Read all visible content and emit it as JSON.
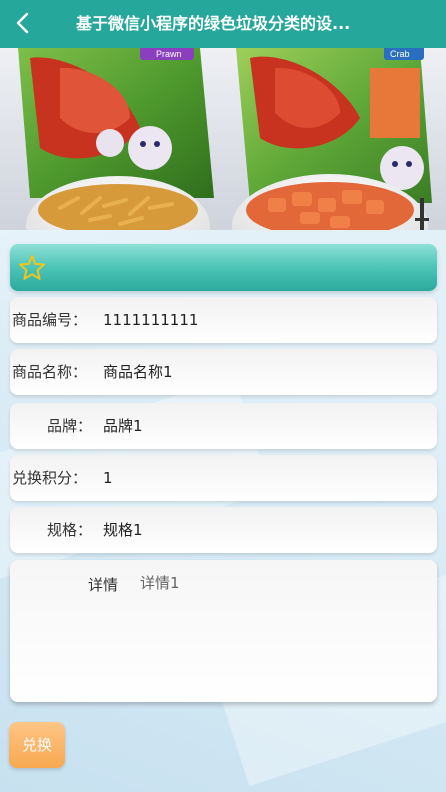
{
  "nav": {
    "title": "基于微信小程序的绿色垃圾分类的设...",
    "back_icon": "chevron-left-icon",
    "background": "#26a79c"
  },
  "banner": {
    "left_bag_label": "Prawn",
    "right_bag_label": "Crab"
  },
  "favorite": {
    "icon": "star-icon",
    "star_color": "#f4c518"
  },
  "fields": {
    "product_code": {
      "label": "商品编号：",
      "value": "1111111111"
    },
    "product_name": {
      "label": "商品名称：",
      "value": "商品名称1"
    },
    "brand": {
      "label": "品牌：",
      "value": "品牌1"
    },
    "points": {
      "label": "兑换积分：",
      "value": "1"
    },
    "spec": {
      "label": "规格：",
      "value": "规格1"
    }
  },
  "detail": {
    "label": "详情",
    "value": "详情1"
  },
  "actions": {
    "exchange_label": "兑换"
  }
}
